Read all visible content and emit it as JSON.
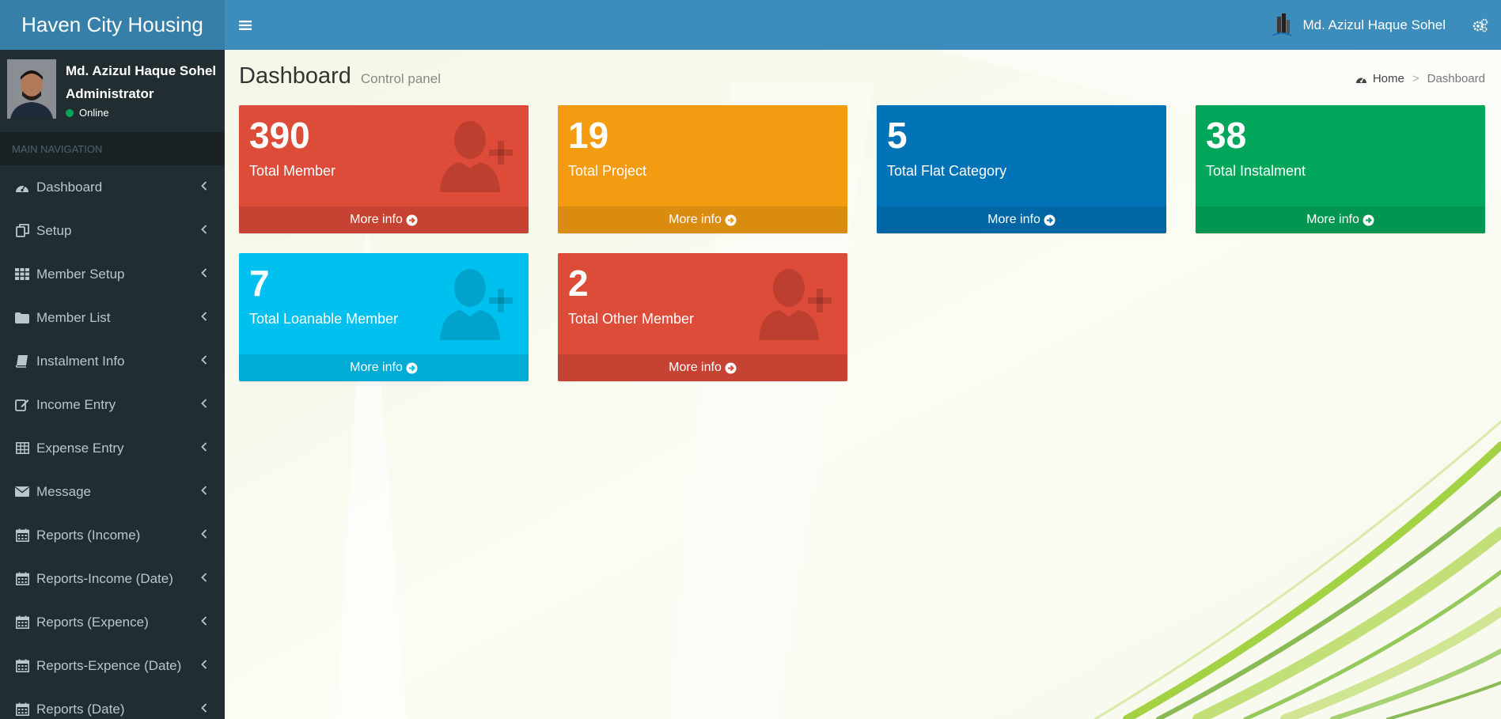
{
  "header": {
    "app_title": "Haven City Housing",
    "user_name": "Md. Azizul Haque Sohel"
  },
  "sidebar": {
    "user": {
      "name": "Md. Azizul Haque Sohel",
      "role": "Administrator",
      "status": "Online"
    },
    "nav_header": "MAIN NAVIGATION",
    "items": [
      {
        "label": "Dashboard",
        "icon": "dashboard-icon"
      },
      {
        "label": "Setup",
        "icon": "copy-icon"
      },
      {
        "label": "Member Setup",
        "icon": "grid-icon"
      },
      {
        "label": "Member List",
        "icon": "folder-icon"
      },
      {
        "label": "Instalment Info",
        "icon": "book-icon"
      },
      {
        "label": "Income Entry",
        "icon": "edit-icon"
      },
      {
        "label": "Expense Entry",
        "icon": "table-icon"
      },
      {
        "label": "Message",
        "icon": "envelope-icon"
      },
      {
        "label": "Reports (Income)",
        "icon": "calendar-icon"
      },
      {
        "label": "Reports-Income (Date)",
        "icon": "calendar-icon"
      },
      {
        "label": "Reports (Expence)",
        "icon": "calendar-icon"
      },
      {
        "label": "Reports-Expence (Date)",
        "icon": "calendar-icon"
      },
      {
        "label": "Reports (Date)",
        "icon": "calendar-icon"
      }
    ]
  },
  "content": {
    "title": "Dashboard",
    "subtitle": "Control panel",
    "breadcrumb": {
      "home": "Home",
      "current": "Dashboard"
    },
    "boxes": [
      {
        "value": "390",
        "label": "Total Member",
        "footer": "More info",
        "color": "#dd4b39",
        "icon": "user-plus-icon"
      },
      {
        "value": "19",
        "label": "Total Project",
        "footer": "More info",
        "color": "#f39c12",
        "icon": ""
      },
      {
        "value": "5",
        "label": "Total Flat Category",
        "footer": "More info",
        "color": "#0073b7",
        "icon": ""
      },
      {
        "value": "38",
        "label": "Total Instalment",
        "footer": "More info",
        "color": "#00a65a",
        "icon": ""
      },
      {
        "value": "7",
        "label": "Total Loanable Member",
        "footer": "More info",
        "color": "#00c0ef",
        "icon": "user-plus-icon"
      },
      {
        "value": "2",
        "label": "Total Other Member",
        "footer": "More info",
        "color": "#dd4b39",
        "icon": "user-plus-icon"
      }
    ]
  }
}
